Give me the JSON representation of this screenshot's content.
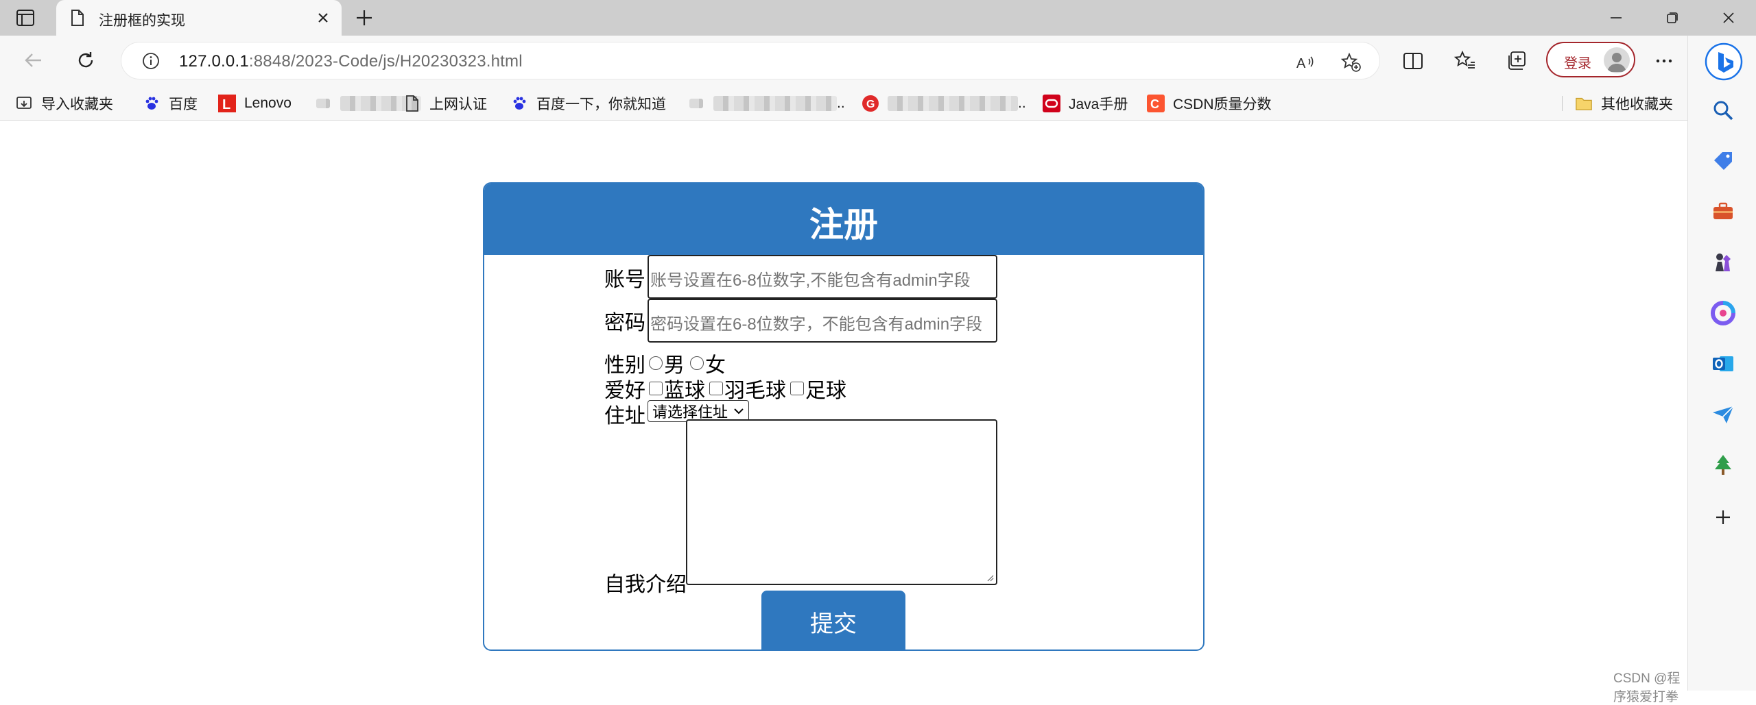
{
  "browser": {
    "tab": {
      "title": "注册框的实现",
      "icon": "page-icon"
    },
    "address": {
      "host": "127.0.0.1",
      "path": ":8848/2023-Code/js/H20230323.html"
    },
    "login_label": "登录"
  },
  "favorites": {
    "items": [
      {
        "label": "导入收藏夹",
        "icon": "import-favorites-icon"
      },
      {
        "label": "百度",
        "icon": "baidu-paw-icon"
      },
      {
        "label": "Lenovo",
        "icon": "lenovo-logo-icon"
      },
      {
        "label": "",
        "icon": "blurred-site-icon"
      },
      {
        "label": "上网认证",
        "icon": "page-icon"
      },
      {
        "label": "百度一下，你就知道",
        "icon": "baidu-paw-icon"
      },
      {
        "label": "..",
        "icon": "blurred-site-icon"
      },
      {
        "label": "..",
        "icon": "red-site-icon"
      },
      {
        "label": "Java手册",
        "icon": "oracle-icon"
      },
      {
        "label": "CSDN质量分数",
        "icon": "csdn-icon"
      }
    ],
    "other_folder": "其他收藏夹"
  },
  "form": {
    "title": "注册",
    "account_label": "账号",
    "account_placeholder": "账号设置在6-8位数字,不能包含有admin字段",
    "password_label": "密码",
    "password_placeholder": "密码设置在6-8位数字，不能包含有admin字段",
    "gender_label": "性别",
    "gender_options": [
      "男",
      "女"
    ],
    "hobby_label": "爱好",
    "hobby_options": [
      "蓝球",
      "羽毛球",
      "足球"
    ],
    "address_label": "住址",
    "address_selected": "请选择住址",
    "intro_label": "自我介绍",
    "submit_label": "提交"
  },
  "watermark": "CSDN @程序猿爱打拳",
  "colors": {
    "accent": "#2f78bf",
    "login_red": "#a4262c"
  }
}
